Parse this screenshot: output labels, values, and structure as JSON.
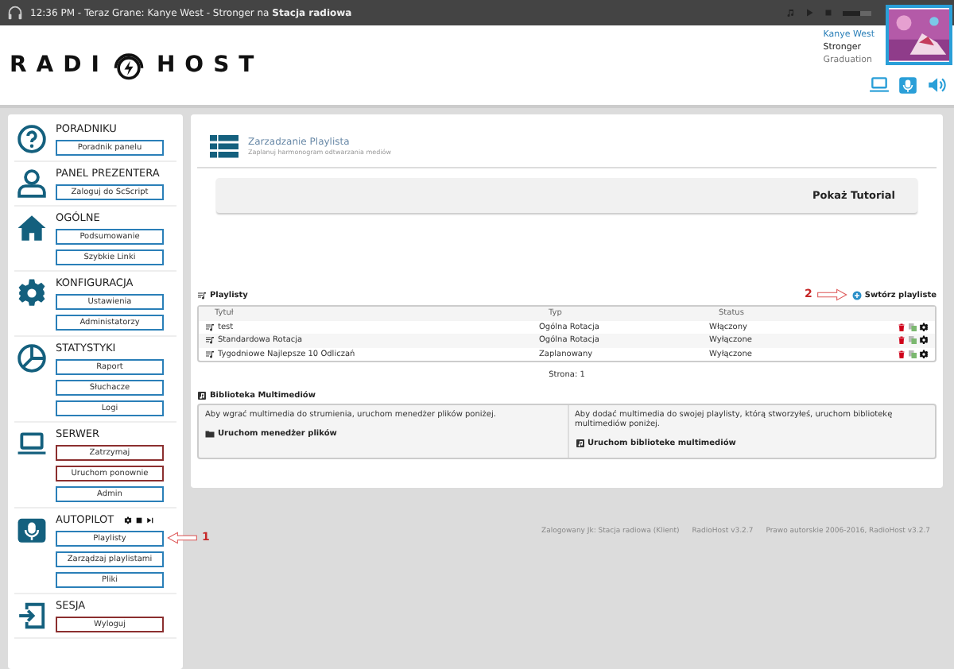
{
  "top_bar": {
    "time": "12:36 PM",
    "now_playing": "- Teraz Grane: Kanye West - Stronger na **Stacja radiowa**",
    "volume": {
      "level": 0.6
    }
  },
  "logo": {
    "left": "RADI",
    "right": "HOST"
  },
  "track": {
    "artist": "Kanye West",
    "title": "Stronger",
    "album": "Graduation"
  },
  "sidebar": [
    {
      "title": "PORADNIKU",
      "buttons": [
        {
          "label": "Poradnik panelu",
          "kind": "default"
        }
      ]
    },
    {
      "title": "PANEL PREZENTERA",
      "buttons": [
        {
          "label": "Zaloguj do ScScript",
          "kind": "default"
        }
      ]
    },
    {
      "title": "OGÓLNE",
      "buttons": [
        {
          "label": "Podsumowanie",
          "kind": "default"
        },
        {
          "label": "Szybkie Linki",
          "kind": "default"
        }
      ]
    },
    {
      "title": "KONFIGURACJA",
      "buttons": [
        {
          "label": "Ustawienia",
          "kind": "default"
        },
        {
          "label": "Administatorzy",
          "kind": "default"
        }
      ]
    },
    {
      "title": "STATYSTYKI",
      "buttons": [
        {
          "label": "Raport",
          "kind": "default"
        },
        {
          "label": "Słuchacze",
          "kind": "default"
        },
        {
          "label": "Logi",
          "kind": "default"
        }
      ]
    },
    {
      "title": "SERWER",
      "buttons": [
        {
          "label": "Zatrzymaj",
          "kind": "danger"
        },
        {
          "label": "Uruchom ponownie",
          "kind": "danger"
        },
        {
          "label": "Admin",
          "kind": "default"
        }
      ]
    },
    {
      "title": "AUTOPILOT",
      "controls": true,
      "buttons": [
        {
          "label": "Playlisty",
          "kind": "default",
          "annotation": "1"
        },
        {
          "label": "Zarządzaj playlistami",
          "kind": "default"
        },
        {
          "label": "Pliki",
          "kind": "default"
        }
      ]
    },
    {
      "title": "SESJA",
      "buttons": [
        {
          "label": "Wyloguj",
          "kind": "danger"
        }
      ]
    }
  ],
  "page": {
    "title": "Zarzadzanie Playlista",
    "subtitle": "Zaplanuj harmonogram odtwarzania mediów",
    "tutorial": "Pokaż Tutorial"
  },
  "playlists": {
    "heading": "Playlisty",
    "create": "Swtórz playliste",
    "create_annotation": "2",
    "columns": [
      "Tytuł",
      "Typ",
      "Status"
    ],
    "rows": [
      {
        "title": "test",
        "type": "Ogólna Rotacja",
        "status": "Włączony"
      },
      {
        "title": "Standardowa Rotacja",
        "type": "Ogólna Rotacja",
        "status": "Wyłączone"
      },
      {
        "title": "Tygodniowe Najlepsze 10 Odliczań",
        "type": "Zaplanowany",
        "status": "Wyłączone"
      }
    ],
    "pager": "Strona: 1"
  },
  "library": {
    "heading": "Biblioteka Multimediów",
    "left": {
      "text": "Aby wgrać multimedia do strumienia, uruchom menedżer plików poniżej.",
      "link": "Uruchom menedżer plików"
    },
    "right": {
      "text": "Aby dodać multimedia do swojej playlisty, którą stworzyłeś, uruchom bibliotekę multimediów poniżej.",
      "link": "Uruchom biblioteke multimediów"
    }
  },
  "footer": [
    "Zalogowany Jk: Stacja radiowa (Klient)",
    "RadioHost v3.2.7",
    "Prawo autorskie 2006-2016, RadioHost v3.2.7"
  ]
}
